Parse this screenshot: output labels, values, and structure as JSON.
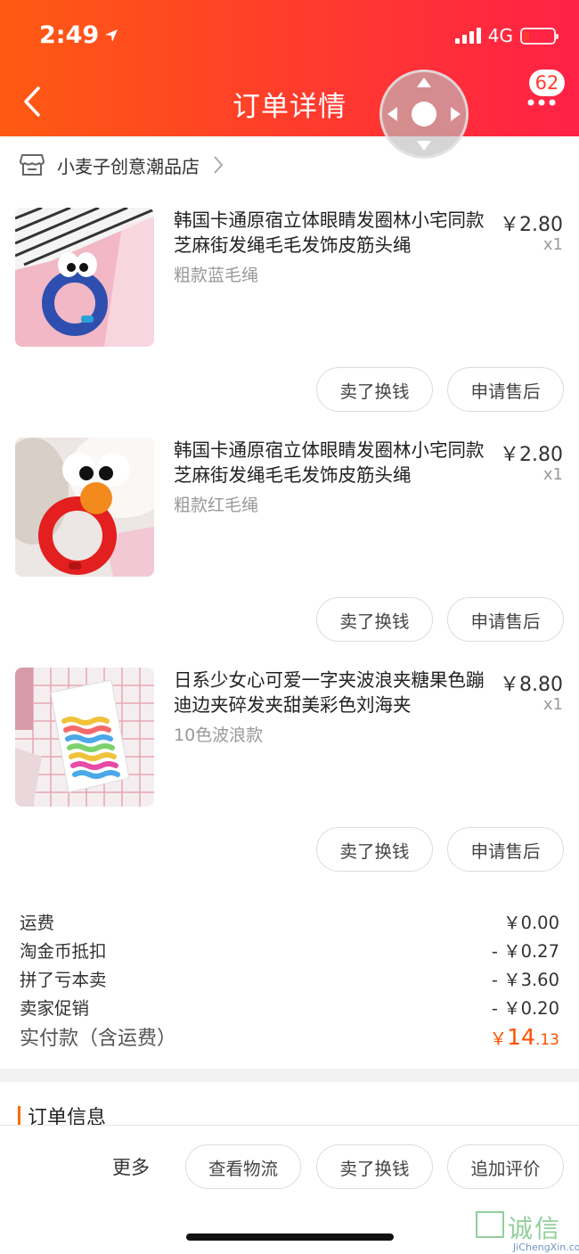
{
  "status_bar": {
    "time": "2:49",
    "network": "4G"
  },
  "header": {
    "title": "订单详情",
    "notification_count": "62"
  },
  "shop": {
    "name": "小麦子创意潮品店"
  },
  "items": [
    {
      "title": "韩国卡通原宿立体眼睛发圈林小宅同款芝麻街发绳毛毛发饰皮筋头绳",
      "spec": "粗款蓝毛绳",
      "price": "￥2.80",
      "qty": "x1",
      "sell_label": "卖了换钱",
      "after_sale_label": "申请售后"
    },
    {
      "title": "韩国卡通原宿立体眼睛发圈林小宅同款芝麻街发绳毛毛发饰皮筋头绳",
      "spec": "粗款红毛绳",
      "price": "￥2.80",
      "qty": "x1",
      "sell_label": "卖了换钱",
      "after_sale_label": "申请售后"
    },
    {
      "title": "日系少女心可爱一字夹波浪夹糖果色蹦迪边夹碎发夹甜美彩色刘海夹",
      "spec": "10色波浪款",
      "price": "￥8.80",
      "qty": "x1",
      "sell_label": "卖了换钱",
      "after_sale_label": "申请售后"
    }
  ],
  "summary": {
    "rows": [
      {
        "label": "运费",
        "value": "￥0.00"
      },
      {
        "label": "淘金币抵扣",
        "value": "- ￥0.27"
      },
      {
        "label": "拼了亏本卖",
        "value": "- ￥3.60"
      },
      {
        "label": "卖家促销",
        "value": "- ￥0.20"
      }
    ],
    "total_label": "实付款（含运费）",
    "total_currency": "￥",
    "total_int": "14",
    "total_dec": ".13"
  },
  "order_info": {
    "title": "订单信息"
  },
  "bottom_bar": {
    "more": "更多",
    "logistics": "查看物流",
    "sell": "卖了换钱",
    "review": "追加评价"
  },
  "watermark": {
    "cn": "诚信",
    "en": "JiChengXin.com"
  },
  "colors": {
    "header_start": "#ff5a12",
    "header_end": "#ff2146",
    "price_accent": "#ff5000"
  }
}
